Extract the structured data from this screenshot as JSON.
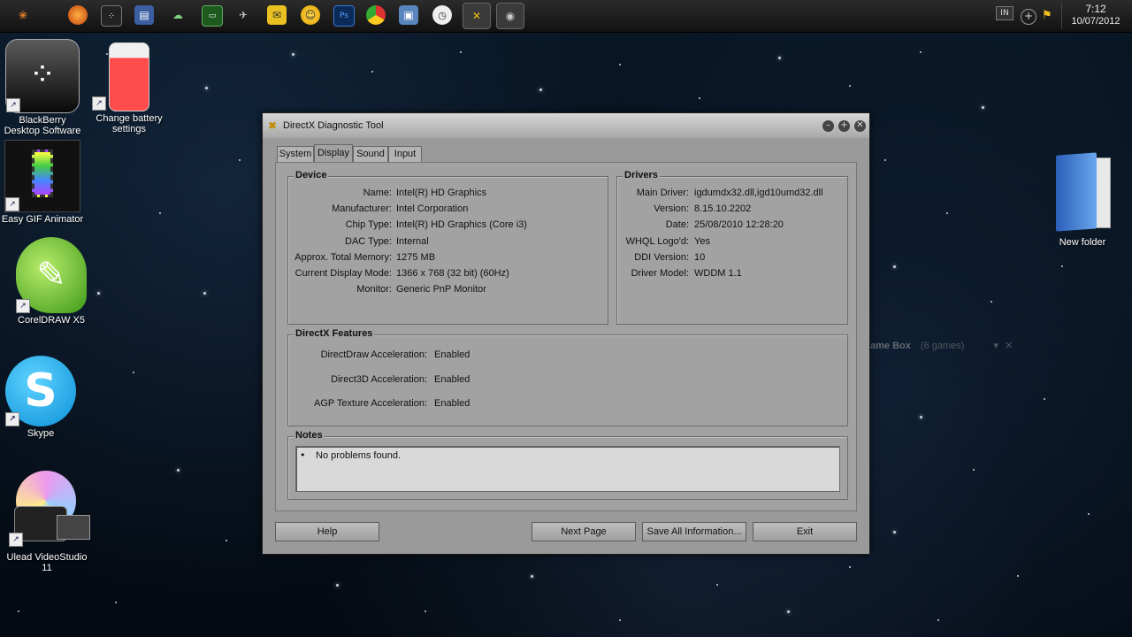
{
  "taskbar": {
    "icons": [
      "start-icon",
      "firefox-icon",
      "blackberry-icon",
      "windows-explorer-icon",
      "cloud-icon",
      "display-icon",
      "tool-icon",
      "mail-icon",
      "messenger-icon",
      "photoshop-icon",
      "chrome-icon",
      "finder-icon",
      "clock-icon",
      "directx-icon",
      "camera-icon"
    ],
    "language": "IN",
    "time": "7:12",
    "date": "10/07/2012"
  },
  "desktop": {
    "icons": [
      {
        "label": "BlackBerry Desktop Software",
        "icon": "blackberry-icon"
      },
      {
        "label": "Change battery settings",
        "icon": "battery-icon"
      },
      {
        "label": "Easy GIF Animator",
        "icon": "film-icon"
      },
      {
        "label": "CorelDRAW X5",
        "icon": "coreldraw-icon"
      },
      {
        "label": "Skype",
        "icon": "skype-icon"
      },
      {
        "label": "Ulead VideoStudio 11",
        "icon": "video-camera-icon"
      },
      {
        "label": "New folder",
        "icon": "folder-icon"
      }
    ],
    "gamebox_title": "ame Box",
    "gamebox_count": "(6 games)"
  },
  "dialog": {
    "title": "DirectX Diagnostic Tool",
    "tabs": [
      "System",
      "Display",
      "Sound",
      "Input"
    ],
    "selected_tab": "Display",
    "device": {
      "title": "Device",
      "rows": [
        {
          "label": "Name:",
          "value": "Intel(R) HD Graphics"
        },
        {
          "label": "Manufacturer:",
          "value": "Intel Corporation"
        },
        {
          "label": "Chip Type:",
          "value": "Intel(R) HD Graphics (Core i3)"
        },
        {
          "label": "DAC Type:",
          "value": "Internal"
        },
        {
          "label": "Approx. Total Memory:",
          "value": "1275 MB"
        },
        {
          "label": "Current Display Mode:",
          "value": "1366 x 768 (32 bit) (60Hz)"
        },
        {
          "label": "Monitor:",
          "value": "Generic PnP Monitor"
        }
      ]
    },
    "drivers": {
      "title": "Drivers",
      "rows": [
        {
          "label": "Main Driver:",
          "value": "igdumdx32.dll,igd10umd32.dll"
        },
        {
          "label": "Version:",
          "value": "8.15.10.2202"
        },
        {
          "label": "Date:",
          "value": "25/08/2010 12:28:20"
        },
        {
          "label": "WHQL Logo'd:",
          "value": "Yes"
        },
        {
          "label": "DDI Version:",
          "value": "10"
        },
        {
          "label": "Driver Model:",
          "value": "WDDM 1.1"
        }
      ]
    },
    "features": {
      "title": "DirectX Features",
      "rows": [
        {
          "label": "DirectDraw Acceleration:",
          "value": "Enabled"
        },
        {
          "label": "Direct3D Acceleration:",
          "value": "Enabled"
        },
        {
          "label": "AGP Texture Acceleration:",
          "value": "Enabled"
        }
      ]
    },
    "notes": {
      "title": "Notes",
      "items": [
        "No problems found."
      ]
    },
    "buttons": {
      "help": "Help",
      "next": "Next Page",
      "save": "Save All Information...",
      "exit": "Exit"
    }
  }
}
